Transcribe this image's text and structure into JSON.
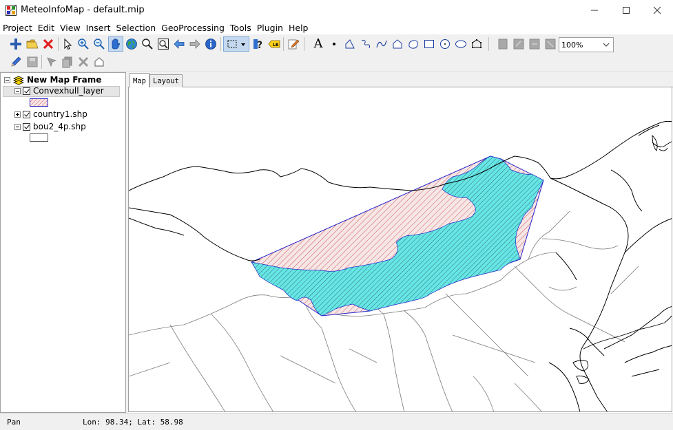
{
  "window": {
    "title": "MeteoInfoMap - default.mip"
  },
  "menu": [
    "Project",
    "Edit",
    "View",
    "Insert",
    "Selection",
    "GeoProcessing",
    "Tools",
    "Plugin",
    "Help"
  ],
  "toolbar": {
    "zoom_value": "100%",
    "text_tool_label": "A"
  },
  "legend": {
    "map_frame": "New Map Frame",
    "layers": [
      {
        "name": "Convexhull_layer",
        "checked": true,
        "expanded": true
      },
      {
        "name": "country1.shp",
        "checked": true,
        "expanded": false
      },
      {
        "name": "bou2_4p.shp",
        "checked": true,
        "expanded": true
      }
    ]
  },
  "tabs": [
    "Map",
    "Layout"
  ],
  "status": {
    "mode": "Pan",
    "coords": "Lon: 98.34; Lat: 58.98"
  },
  "colors": {
    "hull_fill": "#f6e6e6",
    "hull_hatch": "#c83232",
    "hull_stroke": "#2222cc",
    "region_fill": "#66e6e6",
    "region_hatch": "#1a3a3a",
    "country_line": "#000000",
    "province_line": "#7a7a7a"
  }
}
